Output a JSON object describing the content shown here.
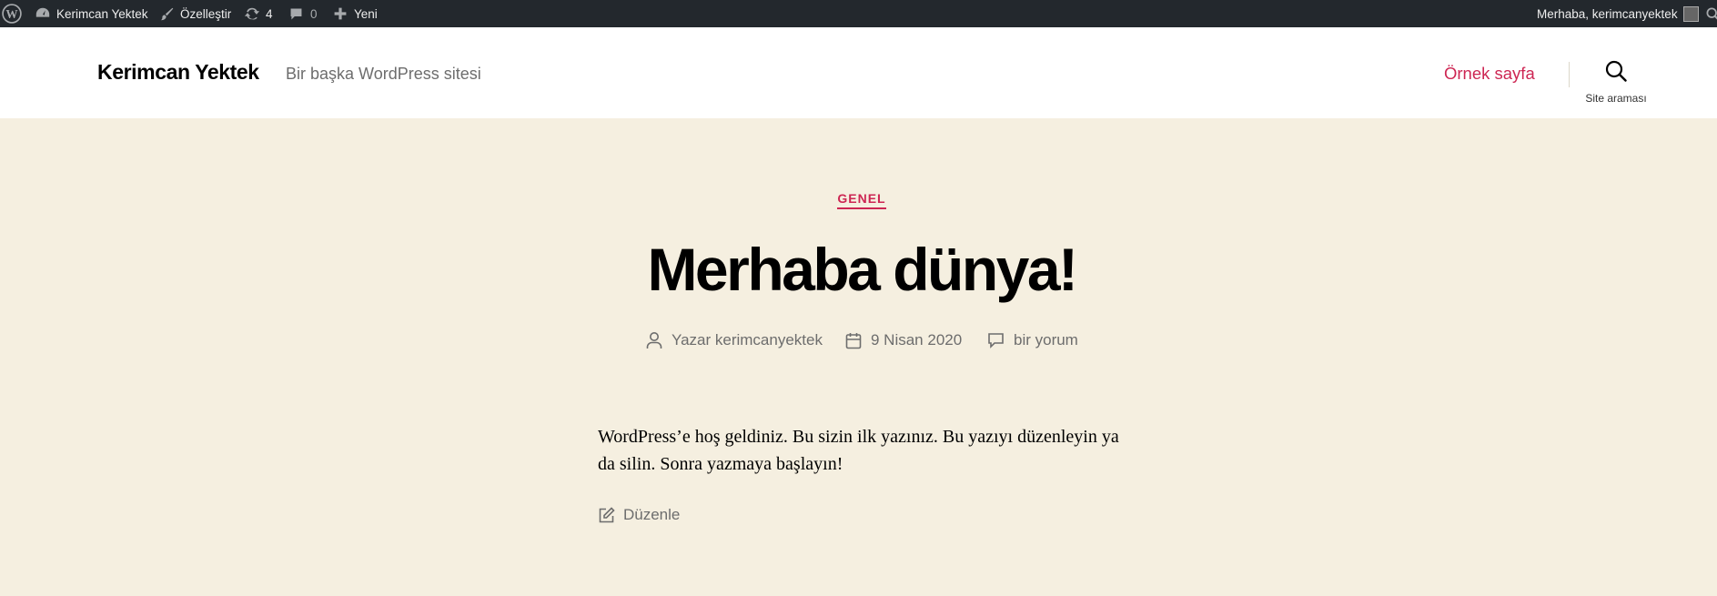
{
  "admin_bar": {
    "site_name": "Kerimcan Yektek",
    "customize": "Özelleştir",
    "updates_count": "4",
    "comments_count": "0",
    "new_label": "Yeni",
    "greeting": "Merhaba, kerimcanyektek"
  },
  "header": {
    "site_title": "Kerimcan Yektek",
    "site_description": "Bir başka WordPress sitesi",
    "nav": [
      "Örnek sayfa"
    ],
    "search_label": "Site araması"
  },
  "post": {
    "category": "GENEL",
    "title": "Merhaba dünya!",
    "author": "Yazar kerimcanyektek",
    "date": "9 Nisan 2020",
    "comments": "bir yorum",
    "content_line1": "WordPress’e hoş geldiniz. Bu sizin ilk yazınız. Bu yazıyı düzenleyin ya",
    "content_line2": "da silin. Sonra yazmaya başlayın!",
    "edit_label": "Düzenle"
  },
  "colors": {
    "accent": "#cd2653",
    "background": "#f5efe0",
    "admin_bar": "#23282d"
  }
}
